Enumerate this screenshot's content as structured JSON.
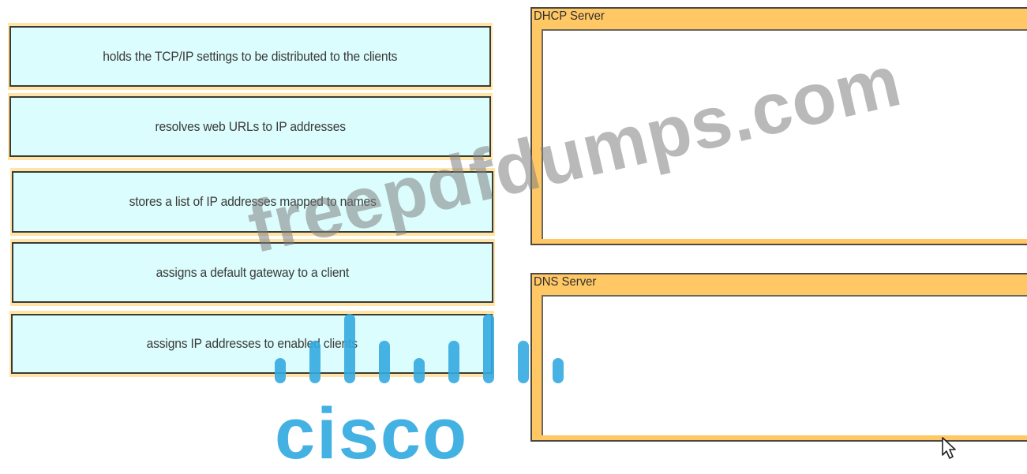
{
  "items": [
    {
      "text": "holds the TCP/IP settings to be distributed to the clients"
    },
    {
      "text": "resolves web URLs to IP addresses"
    },
    {
      "text": "stores a list of IP addresses mapped to names"
    },
    {
      "text": "assigns a default gateway to a client"
    },
    {
      "text": "assigns IP addresses to enabled clients"
    }
  ],
  "targets": [
    {
      "title": "DHCP Server"
    },
    {
      "title": "DNS Server"
    }
  ],
  "watermark": "freepdfdumps.com",
  "logo": {
    "text": "cisco",
    "color": "#34aae1",
    "icon": "cisco-bridge-bars-icon"
  },
  "colors": {
    "item_bg": "#dcfdfd",
    "item_frame": "#ffe4a6",
    "target_header": "#ffc865"
  }
}
